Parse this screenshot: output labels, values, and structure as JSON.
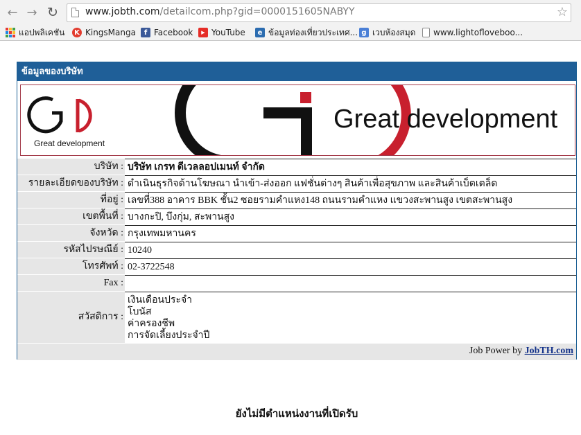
{
  "browser": {
    "url_host": "www.jobth.com",
    "url_path": "/detailcom.php?gid=0000151605NABYY",
    "bookmarks": [
      {
        "label": "แอปพลิเคชัน",
        "icon": "apps-icon"
      },
      {
        "label": "KingsManga",
        "icon": "kingsmanga-icon",
        "color": "#e23b2e"
      },
      {
        "label": "Facebook",
        "icon": "facebook-icon",
        "color": "#3b5998"
      },
      {
        "label": "YouTube",
        "icon": "youtube-icon",
        "color": "#e52d27"
      },
      {
        "label": "ข้อมูลท่องเที่ยวประเทศ...",
        "icon": "travel-icon",
        "color": "#2b6cb0"
      },
      {
        "label": "เวบห้องสมุด",
        "icon": "google-icon",
        "color": "#4a7fd6"
      },
      {
        "label": "www.lightofloveboo...",
        "icon": "page-icon"
      }
    ]
  },
  "company": {
    "header": "ข้อมูลของบริษัท",
    "banner": {
      "small_text": "Great development",
      "big_text": "Great development",
      "colors": {
        "red": "#c8202e",
        "black": "#111111"
      }
    },
    "fields": [
      {
        "label": "บริษัท :",
        "value": "บริษัท เกรท ดีเวลลอปเมนท์ จำกัด",
        "bold": true
      },
      {
        "label": "รายละเอียดของบริษัท :",
        "value": "ดำเนินธุรกิจด้านโฆษณา นำเข้า-ส่งออก แฟชั่นต่างๆ สินค้าเพื่อสุขภาพ และสินค้าเบ็ตเตล็ด"
      },
      {
        "label": "ที่อยู่ :",
        "value": "เลขที่388 อาคาร BBK ชั้น2 ซอยรามคำแหง148 ถนนรามคำแหง แขวงสะพานสูง เขตสะพานสูง"
      },
      {
        "label": "เขตพื้นที่ :",
        "value": "บางกะปิ, บึงกุ่ม, สะพานสูง"
      },
      {
        "label": "จังหวัด :",
        "value": "กรุงเทพมหานคร"
      },
      {
        "label": "รหัสไปรษณีย์ :",
        "value": "10240"
      },
      {
        "label": "โทรศัพท์ :",
        "value": "02-3722548"
      },
      {
        "label": "Fax :",
        "value": ""
      }
    ],
    "benefits_label": "สวัสดิการ :",
    "benefits": [
      "เงินเดือนประจำ",
      "โบนัส",
      "ค่าครองชีพ",
      "การจัดเลี้ยงประจำปี"
    ],
    "footer_prefix": "Job Power by",
    "footer_link": "JobTH.com"
  },
  "notice": "ยังไม่มีตำแหน่งงานที่เปิดรับ"
}
